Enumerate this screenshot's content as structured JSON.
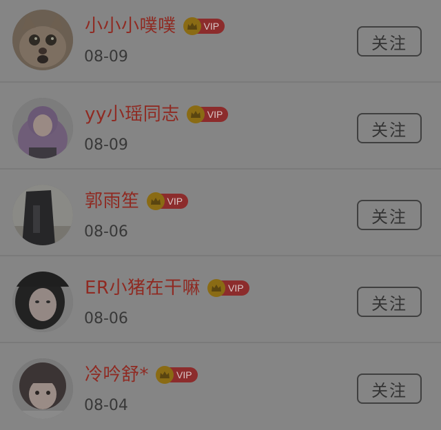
{
  "colors": {
    "background": "#858585",
    "name": "#8f2a22",
    "date": "#383838",
    "button_border": "#3f3f3f",
    "vip_badge": "#8c2c2c",
    "vip_crown": "#8a6b14"
  },
  "follow_label": "关注",
  "vip_label": "VIP",
  "users": [
    {
      "name": "小小小噗噗",
      "date": "08-09",
      "avatar": "cat-photo"
    },
    {
      "name": "yy小瑶同志",
      "date": "08-09",
      "avatar": "purple-hair-girl-photo"
    },
    {
      "name": "郭雨笙",
      "date": "08-06",
      "avatar": "dark-coat-person-photo"
    },
    {
      "name": "ER小猪在干嘛",
      "date": "08-06",
      "avatar": "girl-portrait-photo"
    },
    {
      "name": "冷吟舒*",
      "date": "08-04",
      "avatar": "child-photo"
    }
  ]
}
